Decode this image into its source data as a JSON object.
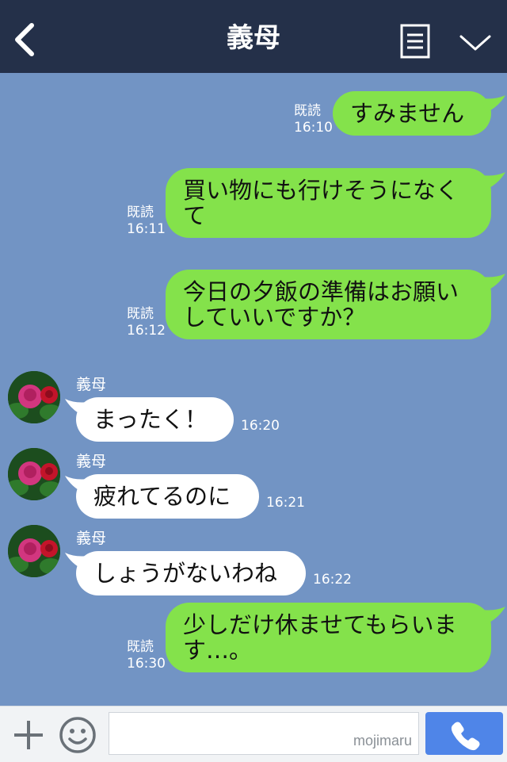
{
  "header": {
    "title": "義母",
    "back_icon": "chevron-left-icon",
    "menu_icon": "menu-list-icon",
    "expand_icon": "chevron-down-icon"
  },
  "messages": [
    {
      "side": "out",
      "text": "すみません",
      "read": "既読",
      "time": "16:10"
    },
    {
      "side": "out",
      "text": "買い物にも行けそうになくて",
      "read": "既読",
      "time": "16:11"
    },
    {
      "side": "out",
      "text": "今日の夕飯の準備はお願いしていいですか？",
      "read": "既読",
      "time": "16:12"
    },
    {
      "side": "in",
      "sender": "義母",
      "text": "まったく！",
      "time": "16:20"
    },
    {
      "side": "in",
      "sender": "義母",
      "text": "疲れてるのに",
      "time": "16:21"
    },
    {
      "side": "in",
      "sender": "義母",
      "text": "しょうがないわね",
      "time": "16:22"
    },
    {
      "side": "out",
      "text": "少しだけ休ませてもらいます…。",
      "read": "既読",
      "time": "16:30"
    }
  ],
  "footer": {
    "plus_icon": "plus-icon",
    "emoji_icon": "smiley-icon",
    "input_value": "",
    "watermark": "mojimaru",
    "send_icon": "phone-icon"
  },
  "colors": {
    "header_bg": "#243049",
    "chat_bg": "#7294c4",
    "outgoing_bubble": "#84e24b",
    "incoming_bubble": "#ffffff",
    "send_button": "#4f85e8"
  }
}
